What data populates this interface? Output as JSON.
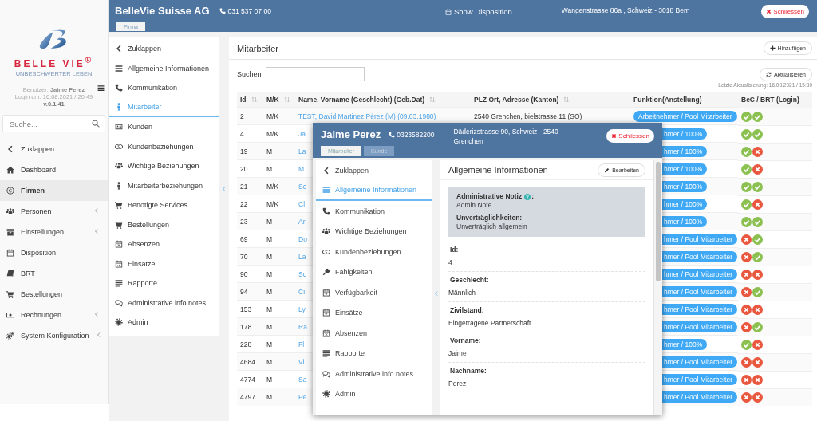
{
  "sidebar": {
    "logo": {
      "brand": "BELLE VIE$^{®}$",
      "tagline": "UNBESCHWERTER LEBEN"
    },
    "user": "Benutzer: **Jaime Perez**",
    "login": "Login um: 16.08.2021 / 20:49",
    "version": "v.0.1.41",
    "search": {
      "placeholder": "Suche..."
    },
    "items": [
      {
        "label": "Zuklappen",
        "selected": false,
        "has_submenu": false
      },
      {
        "label": "Dashboard",
        "selected": false,
        "has_submenu": false
      },
      {
        "label": "Firmen",
        "selected": true,
        "has_submenu": false
      },
      {
        "label": "Personen",
        "selected": false,
        "has_submenu": true
      },
      {
        "label": "Einstellungen",
        "selected": false,
        "has_submenu": true
      },
      {
        "label": "Disposition",
        "selected": false,
        "has_submenu": false
      },
      {
        "label": "BRT",
        "selected": false,
        "has_submenu": false
      },
      {
        "label": "Bestellungen",
        "selected": false,
        "has_submenu": false
      },
      {
        "label": "Rechnungen",
        "selected": false,
        "has_submenu": true
      },
      {
        "label": "System Konfiguration",
        "selected": false,
        "has_submenu": true
      }
    ]
  },
  "header": {
    "title": "BelleVie Suisse AG",
    "phone": "031 537 07 00",
    "disposition": "Show Disposition",
    "address": "Wangenstrasse 86a , Schweiz - 3018 Bern",
    "close": "Schliessen",
    "tabs": [
      {
        "label": "Firma",
        "selected": true
      }
    ]
  },
  "submenu": {
    "items": [
      {
        "label": "Zuklappen",
        "selected": false
      },
      {
        "label": "Allgemeine Informationen",
        "selected": false
      },
      {
        "label": "Kommunikation",
        "selected": false
      },
      {
        "label": "Mitarbeiter",
        "selected": true
      },
      {
        "label": "Kunden",
        "selected": false
      },
      {
        "label": "Kundenbeziehungen",
        "selected": false
      },
      {
        "label": "Wichtige Beziehungen",
        "selected": false
      },
      {
        "label": "Mitarbeiterbeziehungen",
        "selected": false
      },
      {
        "label": "Benötigte Services",
        "selected": false
      },
      {
        "label": "Bestellungen",
        "selected": false
      },
      {
        "label": "Absenzen",
        "selected": false
      },
      {
        "label": "Einsätze",
        "selected": false
      },
      {
        "label": "Rapporte",
        "selected": false
      },
      {
        "label": "Administrative info notes",
        "selected": false
      },
      {
        "label": "Admin",
        "selected": false
      }
    ]
  },
  "main": {
    "title": "Mitarbeiter",
    "add": "Hinzufügen",
    "search_label": "Suchen",
    "refresh": "Aktualisieren",
    "last_update": "Letzte Aktualisierung: 16.08.2021 / 15:30",
    "table": {
      "columns": [
        "Id",
        "M/K",
        "Name, Vorname (Geschlecht) (Geb.Dat)",
        "PLZ Ort, Adresse (Kanton)",
        "Funktion(Anstellung)",
        "BeC / BRT (Login)"
      ],
      "rows": [
        {
          "id": "2",
          "mk": "M/K",
          "name": "TEST, David Martinez Pérez (M) (09.03.1980)",
          "address": "2540 Grenchen, bielstrasse 11 (SO)",
          "function": "Arbeitnehmer / Pool Mitarbeiter",
          "bec": true,
          "brt": true
        },
        {
          "id": "4",
          "mk": "M/K",
          "name": "Ja",
          "function": "hmer / 100%",
          "bec": true,
          "brt": true
        },
        {
          "id": "19",
          "mk": "M",
          "name": "La",
          "function": "hmer / 100%",
          "bec": true,
          "brt": false
        },
        {
          "id": "20",
          "mk": "M",
          "name": "M",
          "function": "hmer / 100%",
          "bec": true,
          "brt": false
        },
        {
          "id": "21",
          "mk": "M/K",
          "name": "Sc",
          "function": "hmer / 100%",
          "bec": true,
          "brt": true
        },
        {
          "id": "22",
          "mk": "M/K",
          "name": "Cl",
          "function": "hmer / 100%",
          "bec": true,
          "brt": false
        },
        {
          "id": "23",
          "mk": "M",
          "name": "Ar",
          "function": "hmer / 100%",
          "bec": true,
          "brt": true
        },
        {
          "id": "69",
          "mk": "M",
          "name": "Do",
          "function": "hmer / Pool Mitarbeiter",
          "bec": false,
          "brt": true
        },
        {
          "id": "70",
          "mk": "M",
          "name": "La",
          "function": "hmer / Pool Mitarbeiter",
          "bec": false,
          "brt": true
        },
        {
          "id": "90",
          "mk": "M",
          "name": "Sc",
          "function": "hmer / Pool Mitarbeiter",
          "bec": false,
          "brt": false
        },
        {
          "id": "94",
          "mk": "M",
          "name": "Ci",
          "function": "hmer / Pool Mitarbeiter",
          "bec": false,
          "brt": true
        },
        {
          "id": "153",
          "mk": "M",
          "name": "Ly",
          "function": "hmer / Pool Mitarbeiter",
          "bec": false,
          "brt": false
        },
        {
          "id": "178",
          "mk": "M",
          "name": "Ra",
          "function": "hmer / Pool Mitarbeiter",
          "bec": false,
          "brt": true
        },
        {
          "id": "228",
          "mk": "M",
          "name": "Fl",
          "function": "hmer / 100%",
          "bec": true,
          "brt": false
        },
        {
          "id": "4684",
          "mk": "M",
          "name": "Vi",
          "function": "hmer / Pool Mitarbeiter",
          "bec": false,
          "brt": false
        },
        {
          "id": "4774",
          "mk": "M",
          "name": "Sa",
          "function": "hmer / Pool Mitarbeiter",
          "bec": false,
          "brt": false
        },
        {
          "id": "4797",
          "mk": "M",
          "name": "Pe",
          "function": "hmer / Pool Mitarbeiter",
          "bec": false,
          "brt": false
        }
      ]
    }
  },
  "modal": {
    "name": "Jaime Perez",
    "phone": "0323582200",
    "address": "Däderizstrasse 90, Schweiz - 2540 Grenchen",
    "close": "Schliessen",
    "tabs": [
      {
        "label": "Mitarbeiter",
        "selected": true
      },
      {
        "label": "Kunde",
        "selected": false
      }
    ],
    "menu": [
      {
        "label": "Zuklappen",
        "selected": false
      },
      {
        "label": "Allgemeine Informationen",
        "selected": true
      },
      {
        "label": "Kommunikation",
        "selected": false
      },
      {
        "label": "Wichtige Beziehungen",
        "selected": false
      },
      {
        "label": "Kundenbeziehungen",
        "selected": false
      },
      {
        "label": "Fähigkeiten",
        "selected": false
      },
      {
        "label": "Verfügbarkeit",
        "selected": false
      },
      {
        "label": "Einsätze",
        "selected": false
      },
      {
        "label": "Absenzen",
        "selected": false
      },
      {
        "label": "Rapporte",
        "selected": false
      },
      {
        "label": "Administrative info notes",
        "selected": false
      },
      {
        "label": "Admin",
        "selected": false
      }
    ],
    "panel_title": "Allgemeine Informationen",
    "edit": "Bearbeiten",
    "note": {
      "label": "Administrative Notiz",
      "colon": ":",
      "value": "Admin Note",
      "label_2": "Unverträglichkeiten:",
      "value_2": "Unverträglich allgemein"
    },
    "fields": [
      {
        "label": "Id:",
        "value": "4"
      },
      {
        "label": "Geschlecht:",
        "value": "Männlich"
      },
      {
        "label": "Zivilstand:",
        "value": "Eingetragene Partnerschaft"
      },
      {
        "label": "Vorname:",
        "value": "Jaime"
      },
      {
        "label": "Nachname:",
        "value": "Perez"
      }
    ]
  }
}
